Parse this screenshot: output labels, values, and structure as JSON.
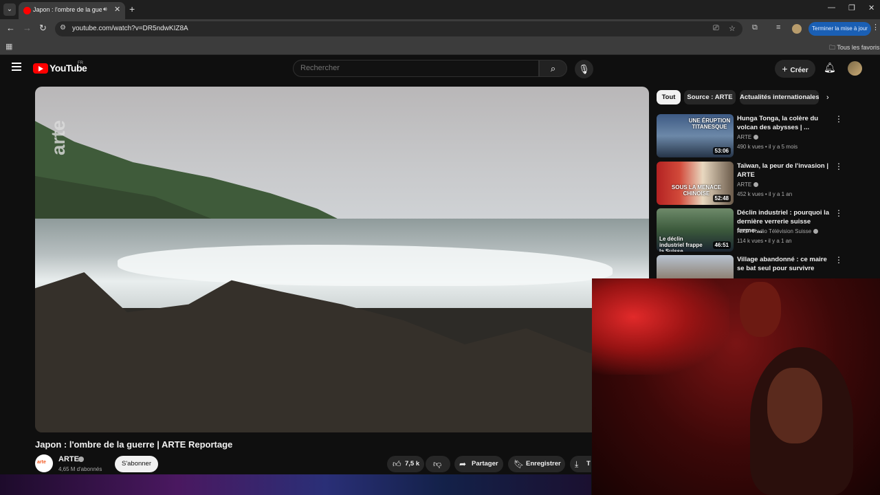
{
  "browser": {
    "tab": {
      "title": "Japon : l'ombre de la guerre",
      "audio_icon": "speaker-icon"
    },
    "url": "youtube.com/watch?v=DR5ndwKIZ8A",
    "update_button": "Terminer la mise à jour",
    "all_bookmarks": "Tous les favoris"
  },
  "youtube": {
    "wordmark": "YouTube",
    "country": "FR",
    "search_placeholder": "Rechercher",
    "create_label": "Créer"
  },
  "video": {
    "watermark": "arte",
    "title": "Japon : l'ombre de la guerre | ARTE Reportage",
    "channel": "ARTE",
    "channel_avatar_text": "arte",
    "subscribers": "4,65 M d'abonnés",
    "subscribe": "S'abonner",
    "likes": "7,5 k",
    "share": "Partager",
    "save": "Enregistrer",
    "download_partial": "T"
  },
  "chips": [
    {
      "label": "Tout"
    },
    {
      "label": "Source : ARTE"
    },
    {
      "label": "Actualités internationales"
    }
  ],
  "recommendations": [
    {
      "title": "Hunga Tonga, la colère du volcan des abysses | ...",
      "channel": "ARTE",
      "meta": "490 k vues • il y a 5 mois",
      "duration": "53:06",
      "thumb_text": "UNE ÉRUPTION TITANESQUE"
    },
    {
      "title": "Taïwan, la peur de l'invasion | ARTE",
      "channel": "ARTE",
      "meta": "452 k vues • il y a 1 an",
      "duration": "52:48",
      "thumb_text": "SOUS LA MENACE CHINOISE"
    },
    {
      "title": "Déclin industriel : pourquoi la dernière verrerie suisse ferme-...",
      "channel": "RTS - Radio Télévision Suisse",
      "meta": "114 k vues • il y a 1 an",
      "duration": "46:51",
      "thumb_text": "Le déclin industriel frappe la Suisse"
    },
    {
      "title": "Village abandonné : ce maire se bat seul pour survivre",
      "channel": "",
      "meta": "",
      "duration": "",
      "thumb_text": ""
    }
  ],
  "colors": {
    "yt_red": "#ff0000",
    "background": "#0f0f0f",
    "chip_active_bg": "#f1f1f1",
    "chip_bg": "#272727",
    "update_btn": "#1a5fb4"
  }
}
